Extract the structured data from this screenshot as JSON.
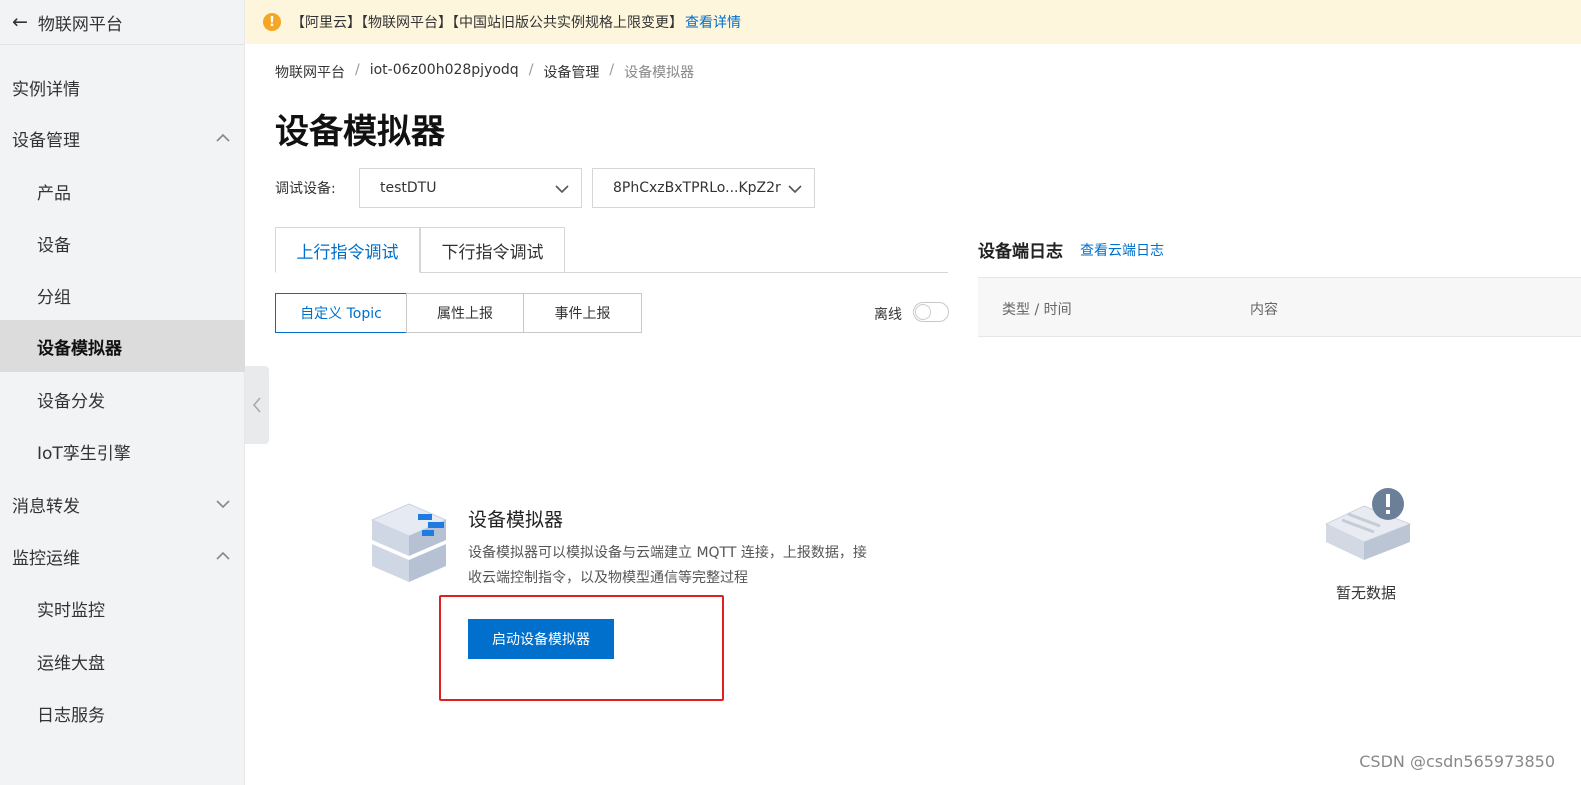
{
  "sidebar": {
    "back_label": "物联网平台",
    "items": [
      {
        "label": "实例详情"
      },
      {
        "label": "设备管理"
      },
      {
        "label": "产品"
      },
      {
        "label": "设备"
      },
      {
        "label": "分组"
      },
      {
        "label": "设备模拟器"
      },
      {
        "label": "设备分发"
      },
      {
        "label": "IoT孪生引擎"
      },
      {
        "label": "消息转发"
      },
      {
        "label": "监控运维"
      },
      {
        "label": "实时监控"
      },
      {
        "label": "运维大盘"
      },
      {
        "label": "日志服务"
      }
    ]
  },
  "banner": {
    "text": "【阿里云】【物联网平台】【中国站旧版公共实例规格上限变更】",
    "link": "查看详情",
    "icon": "warning-icon"
  },
  "breadcrumb": [
    "物联网平台",
    "iot-06z00h028pjyodq",
    "设备管理",
    "设备模拟器"
  ],
  "page_title": "设备模拟器",
  "debug": {
    "label": "调试设备:",
    "product_select": "testDTU",
    "device_select": "8PhCxzBxTPRLo...KpZ2r"
  },
  "tabs": [
    {
      "label": "上行指令调试"
    },
    {
      "label": "下行指令调试"
    }
  ],
  "subtabs": [
    {
      "label": "自定义 Topic"
    },
    {
      "label": "属性上报"
    },
    {
      "label": "事件上报"
    }
  ],
  "status": {
    "offline_label": "离线"
  },
  "simulator": {
    "title": "设备模拟器",
    "desc": "设备模拟器可以模拟设备与云端建立 MQTT 连接，上报数据，接收云端控制指令，以及物模型通信等完整过程",
    "start_button": "启动设备模拟器"
  },
  "log": {
    "title": "设备端日志",
    "link": "查看云端日志",
    "col_type": "类型 / 时间",
    "col_content": "内容",
    "empty": "暂无数据"
  },
  "watermark": "CSDN @csdn565973850",
  "colors": {
    "primary": "#0070cc",
    "warning": "#f5a623",
    "highlight": "#e02020"
  }
}
